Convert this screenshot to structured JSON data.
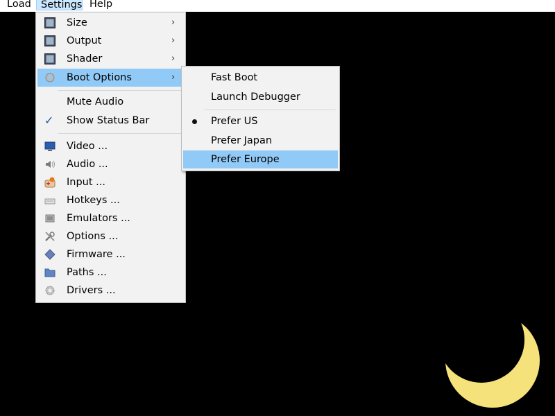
{
  "menubar": {
    "items": [
      {
        "label": "Load"
      },
      {
        "label": "Settings"
      },
      {
        "label": "Help"
      }
    ]
  },
  "settings_menu": {
    "items": [
      {
        "label": "Size",
        "icon": "monitor-image-icon",
        "submenu": true
      },
      {
        "label": "Output",
        "icon": "monitor-image-icon",
        "submenu": true
      },
      {
        "label": "Shader",
        "icon": "monitor-image-icon",
        "submenu": true
      },
      {
        "label": "Boot Options",
        "icon": "gear-icon",
        "submenu": true,
        "highlighted": true
      },
      {
        "label": "Mute Audio",
        "icon": "",
        "submenu": false
      },
      {
        "label": "Show Status Bar",
        "icon": "checkmark-icon",
        "checked": true,
        "submenu": false
      },
      {
        "label": "Video ...",
        "icon": "display-icon"
      },
      {
        "label": "Audio ...",
        "icon": "speaker-icon"
      },
      {
        "label": "Input ...",
        "icon": "joypad-icon"
      },
      {
        "label": "Hotkeys ...",
        "icon": "keyboard-icon"
      },
      {
        "label": "Emulators ...",
        "icon": "chip-icon"
      },
      {
        "label": "Options ...",
        "icon": "tools-icon"
      },
      {
        "label": "Firmware ...",
        "icon": "diamond-icon"
      },
      {
        "label": "Paths ...",
        "icon": "folder-icon"
      },
      {
        "label": "Drivers ...",
        "icon": "gear-icon"
      }
    ]
  },
  "boot_options_menu": {
    "items": [
      {
        "label": "Fast Boot"
      },
      {
        "label": "Launch Debugger"
      },
      {
        "label": "Prefer US",
        "selected": true
      },
      {
        "label": "Prefer Japan"
      },
      {
        "label": "Prefer Europe",
        "highlighted": true
      }
    ]
  },
  "colors": {
    "menu_bg": "#f2f2f2",
    "highlight": "#91c9f7",
    "moon": "#f6e27a",
    "screen": "#000000"
  }
}
